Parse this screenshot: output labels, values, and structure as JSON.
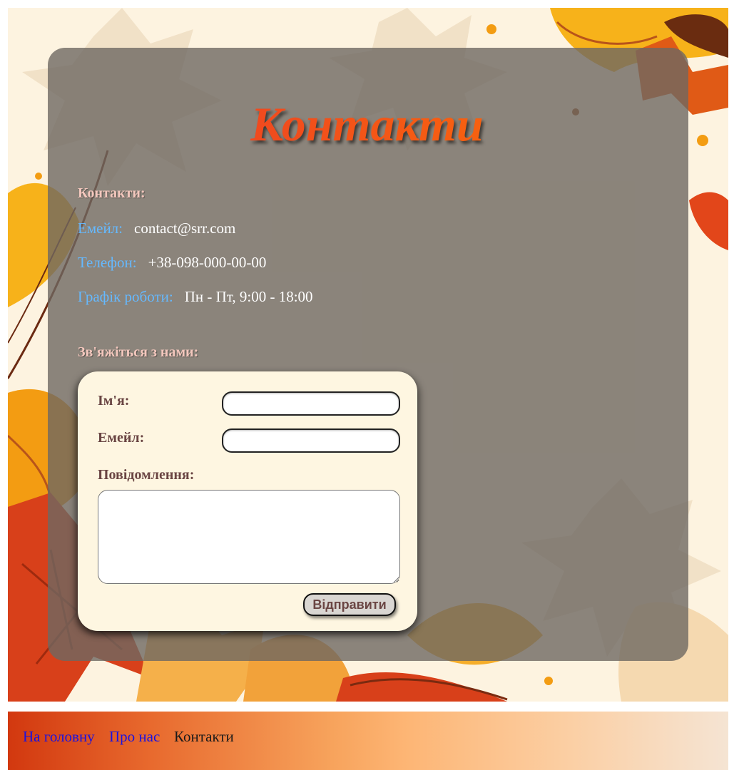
{
  "page": {
    "title": "Контакти"
  },
  "contacts": {
    "heading": "Контакти:",
    "email_label": "Емейл:",
    "email_value": "contact@srr.com",
    "phone_label": "Телефон:",
    "phone_value": "+38-098-000-00-00",
    "hours_label": "Графік роботи:",
    "hours_value": "Пн - Пт, 9:00 - 18:00"
  },
  "form": {
    "heading": "Зв'яжіться з нами:",
    "name_label": "Ім'я:",
    "name_value": "",
    "email_label": "Емейл:",
    "email_value": "",
    "message_label": "Повідомлення:",
    "message_value": "",
    "submit_label": "Відправити"
  },
  "footer": {
    "nav": [
      {
        "label": "На головну",
        "state": "link"
      },
      {
        "label": "Про нас",
        "state": "link"
      },
      {
        "label": "Контакти",
        "state": "current"
      }
    ]
  },
  "colors": {
    "title_gradient": [
      "#e8202c",
      "#ff7a00"
    ],
    "panel": "#6e6861",
    "label_blue": "#65b9ff",
    "heading_pink": "#f3c7bd",
    "form_bg": "#fef6e1",
    "form_text": "#6a4543",
    "link": "#1a12e0"
  }
}
